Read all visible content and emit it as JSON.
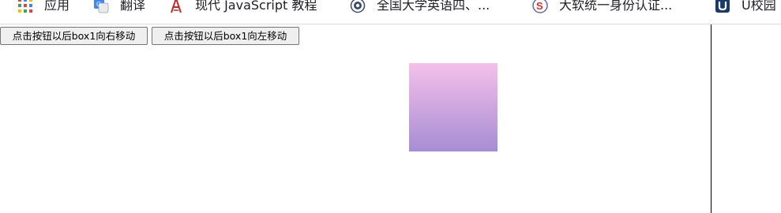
{
  "bookmarks": [
    {
      "label": "应用",
      "icon": "apps-grid-icon"
    },
    {
      "label": "翻译",
      "icon": "translate-icon"
    },
    {
      "label": "现代 JavaScript 教程",
      "icon": "javascript-tutorial-icon"
    },
    {
      "label": "全国大学英语四、...",
      "icon": "cet-seal-icon"
    },
    {
      "label": "大软统一身份认证...",
      "icon": "auth-logo-icon"
    },
    {
      "label": "U校园",
      "icon": "ucampus-icon"
    }
  ],
  "buttons": {
    "move_right_label": "点击按钮以后box1向右移动",
    "move_left_label": "点击按钮以后box1向左移动"
  },
  "box1": {
    "gradient_top": "#f5c0ea",
    "gradient_bottom": "#a68dd3"
  }
}
